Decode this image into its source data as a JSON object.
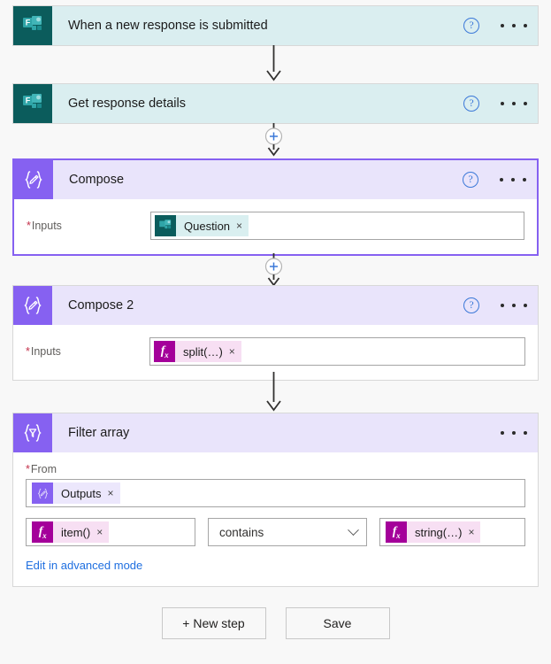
{
  "theme": {
    "page_bg": "#f8f8f8",
    "teal_accent": "#0b5c5c",
    "teal_header": "#daeef0",
    "purple_accent": "#8661f1",
    "purple_header": "#e9e4fb",
    "fx_magenta": "#a4009a",
    "link_blue": "#1f6fe0",
    "required_red": "#c4314b"
  },
  "steps": [
    {
      "id": "trigger",
      "title": "When a new response is submitted",
      "icon": "microsoft-forms-icon",
      "help_label": "?",
      "menu_label": "•••"
    },
    {
      "id": "get-response-details",
      "title": "Get response details",
      "icon": "microsoft-forms-icon",
      "help_label": "?",
      "menu_label": "•••"
    },
    {
      "id": "compose",
      "title": "Compose",
      "icon": "compose-icon",
      "help_label": "?",
      "menu_label": "•••",
      "field_label": "Inputs",
      "field_required": "*",
      "token": {
        "text": "Question",
        "icon": "microsoft-forms-icon",
        "remove_label": "×"
      }
    },
    {
      "id": "compose-2",
      "title": "Compose 2",
      "icon": "compose-icon",
      "help_label": "?",
      "menu_label": "•••",
      "field_label": "Inputs",
      "field_required": "*",
      "token": {
        "text": "split(…)",
        "icon": "fx-icon",
        "remove_label": "×"
      }
    },
    {
      "id": "filter-array",
      "title": "Filter array",
      "icon": "filter-icon",
      "menu_label": "•••",
      "from_label": "From",
      "from_required": "*",
      "from_token": {
        "text": "Outputs",
        "icon": "compose-icon",
        "remove_label": "×"
      },
      "condition": {
        "left_token": {
          "text": "item()",
          "icon": "fx-icon",
          "remove_label": "×"
        },
        "operator": "contains",
        "right_token": {
          "text": "string(…)",
          "icon": "fx-icon",
          "remove_label": "×"
        }
      },
      "advanced_link": "Edit in advanced mode"
    }
  ],
  "connectors": {
    "add_step_label": "+"
  },
  "footer": {
    "new_step_label": "+ New step",
    "save_label": "Save"
  }
}
